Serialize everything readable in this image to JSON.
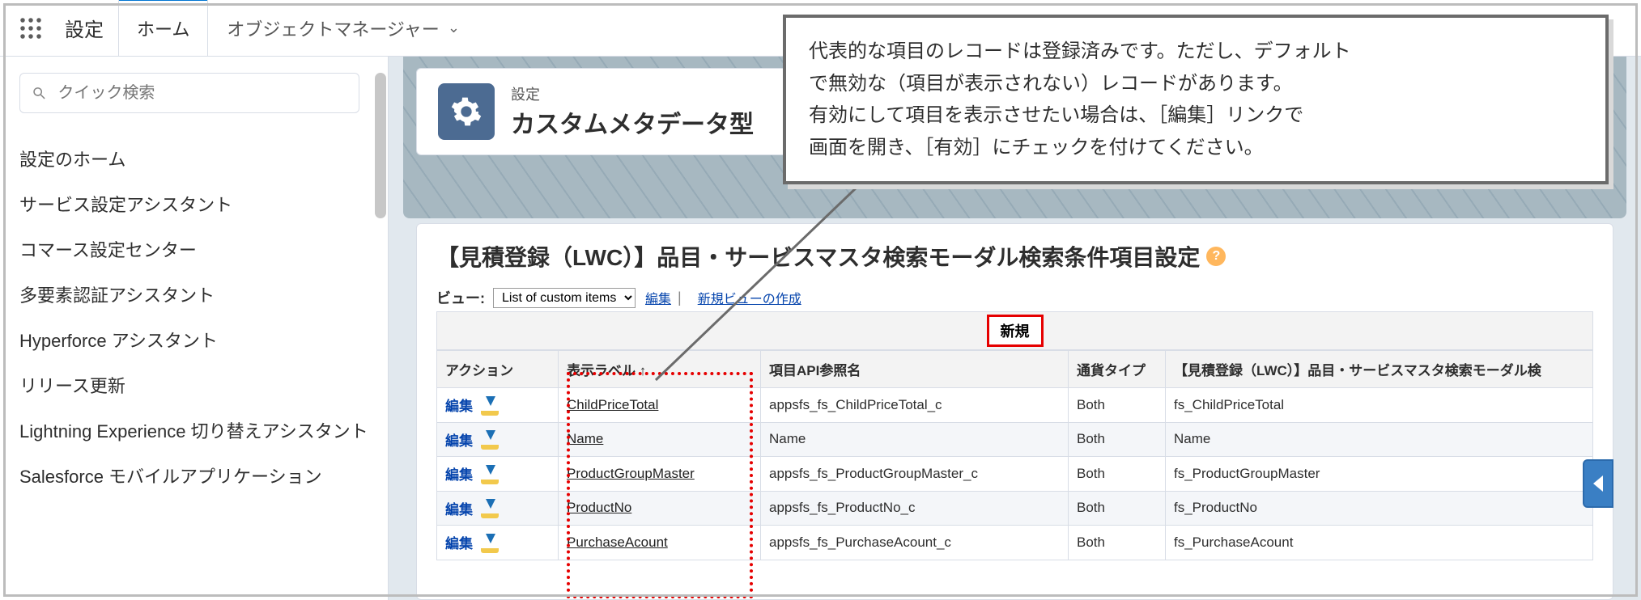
{
  "top": {
    "app_title": "設定",
    "tab_home": "ホーム",
    "tab_obj_mgr": "オブジェクトマネージャー"
  },
  "sidebar": {
    "search_placeholder": "クイック検索",
    "items": [
      "設定のホーム",
      "サービス設定アシスタント",
      "コマース設定センター",
      "多要素認証アシスタント",
      "Hyperforce アシスタント",
      "リリース更新",
      "Lightning Experience 切り替えアシスタント",
      "Salesforce モバイルアプリケーション"
    ]
  },
  "page": {
    "eyebrow": "設定",
    "title": "カスタムメタデータ型",
    "content_title": "【見積登録（LWC）】品目・サービスマスタ検索モーダル検索条件項目設定",
    "view_label": "ビュー:",
    "view_select": "List of custom items",
    "view_edit": "編集",
    "view_new": "新規ビューの作成",
    "new_btn": "新規",
    "columns": {
      "action": "アクション",
      "label": "表示ラベル ↑",
      "api": "項目API参照名",
      "currency": "通貨タイプ",
      "long": "【見積登録（LWC）】品目・サービスマスタ検索モーダル検"
    },
    "rows": [
      {
        "action": "編集",
        "label": "ChildPriceTotal",
        "api": "appsfs_fs_ChildPriceTotal_c",
        "currency": "Both",
        "long": "fs_ChildPriceTotal"
      },
      {
        "action": "編集",
        "label": "Name",
        "api": "Name",
        "currency": "Both",
        "long": "Name"
      },
      {
        "action": "編集",
        "label": "ProductGroupMaster",
        "api": "appsfs_fs_ProductGroupMaster_c",
        "currency": "Both",
        "long": "fs_ProductGroupMaster"
      },
      {
        "action": "編集",
        "label": "ProductNo",
        "api": "appsfs_fs_ProductNo_c",
        "currency": "Both",
        "long": "fs_ProductNo"
      },
      {
        "action": "編集",
        "label": "PurchaseAcount",
        "api": "appsfs_fs_PurchaseAcount_c",
        "currency": "Both",
        "long": "fs_PurchaseAcount"
      }
    ]
  },
  "annotation": {
    "l1": "代表的な項目のレコードは登録済みです。ただし、デフォルト",
    "l2": "で無効な（項目が表示されない）レコードがあります。",
    "l3": "有効にして項目を表示させたい場合は、［編集］リンクで",
    "l4": "画面を開き、［有効］にチェックを付けてください。"
  },
  "help_glyph": "?"
}
